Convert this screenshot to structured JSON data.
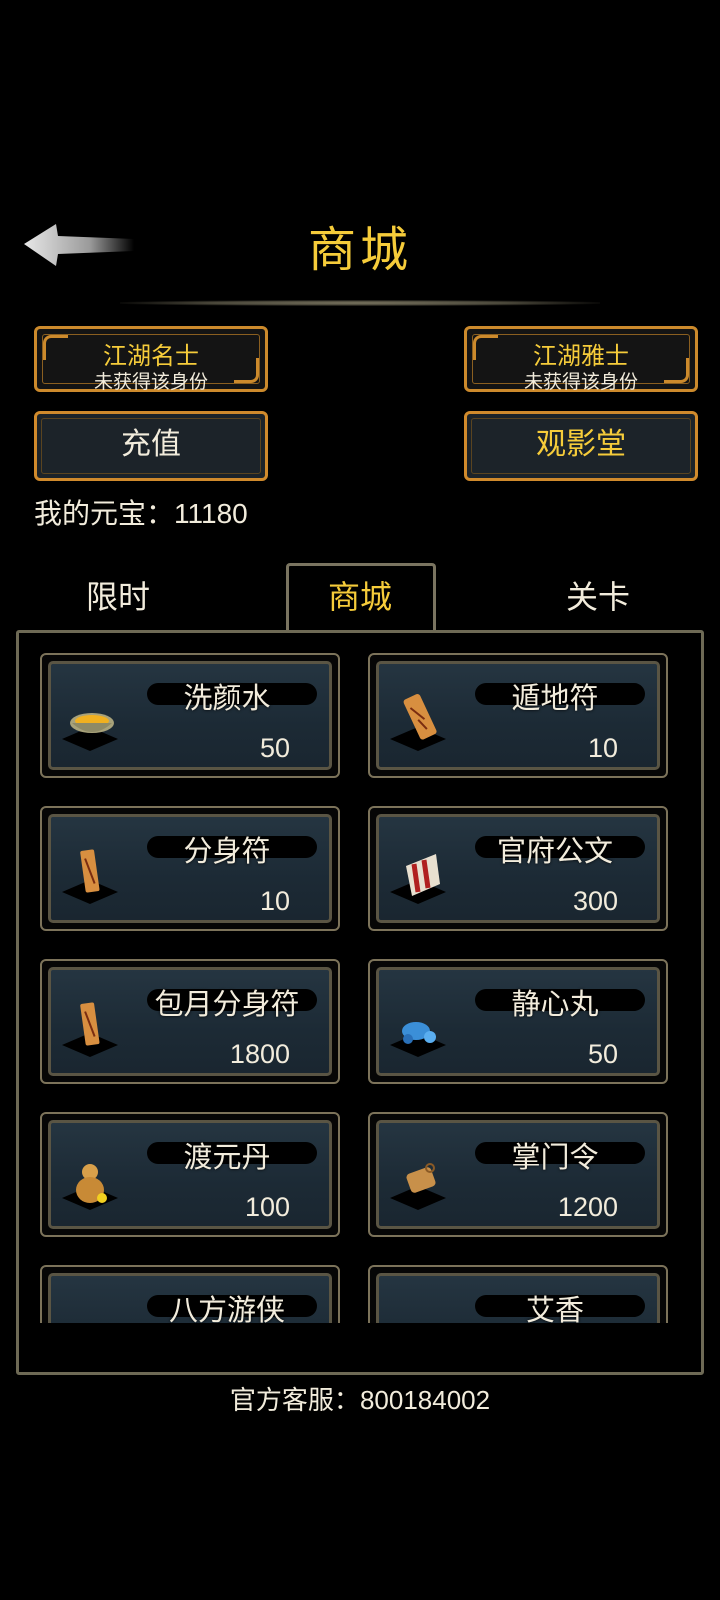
{
  "header": {
    "title": "商城"
  },
  "ranks": [
    {
      "name": "江湖名士",
      "status": "未获得该身份"
    },
    {
      "name": "江湖雅士",
      "status": "未获得该身份"
    }
  ],
  "buttons": {
    "recharge": "充值",
    "theater": "观影堂"
  },
  "currency": {
    "label": "我的元宝：",
    "value": "11180"
  },
  "tabs": [
    {
      "label": "限时",
      "active": false
    },
    {
      "label": "商城",
      "active": true
    },
    {
      "label": "关卡",
      "active": false
    }
  ],
  "items": [
    {
      "name": "洗颜水",
      "price": "50",
      "icon": "bowl-icon"
    },
    {
      "name": "遁地符",
      "price": "10",
      "icon": "talisman-icon"
    },
    {
      "name": "分身符",
      "price": "10",
      "icon": "talisman-icon"
    },
    {
      "name": "官府公文",
      "price": "300",
      "icon": "scroll-icon"
    },
    {
      "name": "包月分身符",
      "price": "1800",
      "icon": "talisman-icon"
    },
    {
      "name": "静心丸",
      "price": "50",
      "icon": "pills-icon"
    },
    {
      "name": "渡元丹",
      "price": "100",
      "icon": "gourd-icon"
    },
    {
      "name": "掌门令",
      "price": "1200",
      "icon": "token-icon"
    },
    {
      "name": "八方游侠",
      "price": "",
      "icon": "mask-icon"
    },
    {
      "name": "艾香",
      "price": "",
      "icon": "incense-icon"
    }
  ],
  "footer": {
    "label": "官方客服：",
    "value": "800184002"
  },
  "colors": {
    "gold": "#f6cc3a",
    "border": "#cc8a2c",
    "card_bg": "#1c2a35"
  }
}
